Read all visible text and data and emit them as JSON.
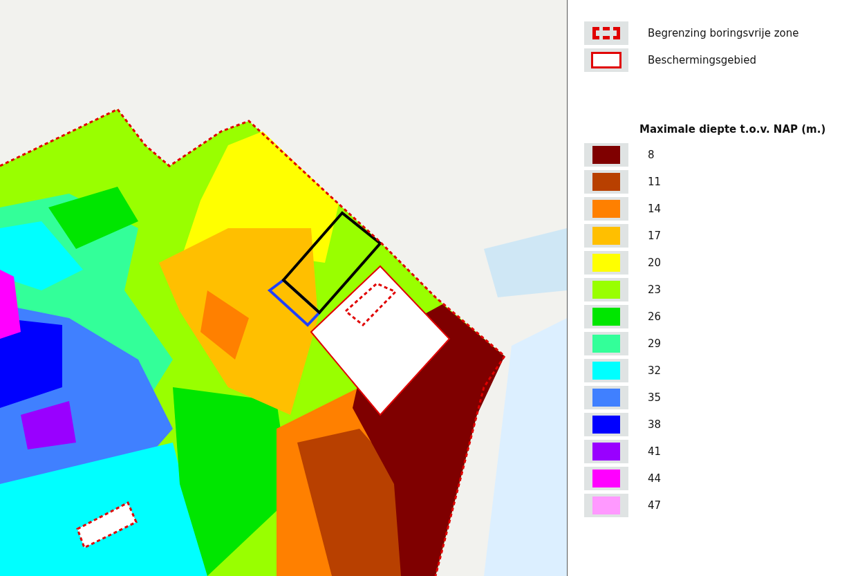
{
  "legend": {
    "symbols": [
      {
        "kind": "dashed",
        "label": "Begrenzing boringsvrije zone"
      },
      {
        "kind": "solid",
        "label": "Beschermingsgebied"
      }
    ],
    "depth_title": "Maximale diepte t.o.v. NAP (m.)",
    "classes": [
      {
        "label": "8",
        "color": "#7f0000"
      },
      {
        "label": "11",
        "color": "#b84000"
      },
      {
        "label": "14",
        "color": "#ff8000"
      },
      {
        "label": "17",
        "color": "#ffbf00"
      },
      {
        "label": "20",
        "color": "#ffff00"
      },
      {
        "label": "23",
        "color": "#99ff00"
      },
      {
        "label": "26",
        "color": "#00e600"
      },
      {
        "label": "29",
        "color": "#33ff99"
      },
      {
        "label": "32",
        "color": "#00ffff"
      },
      {
        "label": "35",
        "color": "#4080ff"
      },
      {
        "label": "38",
        "color": "#0000ff"
      },
      {
        "label": "41",
        "color": "#9900ff"
      },
      {
        "label": "44",
        "color": "#ff00ff"
      },
      {
        "label": "47",
        "color": "#ff99ff"
      }
    ]
  }
}
